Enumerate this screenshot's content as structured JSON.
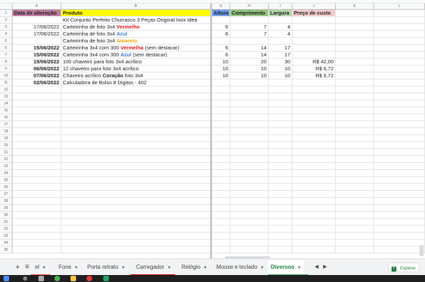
{
  "columns": [
    "A",
    "B",
    "G",
    "H",
    "I",
    "J",
    "K",
    "L"
  ],
  "header": {
    "data": "Data de alteração",
    "produto": "Produto",
    "altura": "Altura",
    "comprimento": "Comprimento",
    "largura": "Largura",
    "preco": "Preço de custo"
  },
  "rows": [
    {
      "n": "2",
      "date": "",
      "prod": "Kit Conjunto Perfeito Churrasco 3 Peças Original Inox Idea",
      "g": "",
      "h": "",
      "i": "",
      "j": ""
    },
    {
      "n": "3",
      "date": "17/06/2022",
      "p1": "Carteirinha de foto 3x4 ",
      "p2": "Vermelho",
      "g": "6",
      "h": "7",
      "i": "4",
      "j": ""
    },
    {
      "n": "4",
      "date": "17/06/2022",
      "p1": "Carteirinha de foto 3x4 ",
      "p2": "Azul",
      "g": "6",
      "h": "7",
      "i": "4",
      "j": ""
    },
    {
      "n": "5",
      "date": "",
      "p1": "Carteirinha de foto 3x4 ",
      "p2": "Amarelo",
      "g": "",
      "h": "",
      "i": "",
      "j": ""
    },
    {
      "n": "6",
      "date": "15/06/2022",
      "p1": "Carteirinha 3x4 com 300 ",
      "p2": "Vermelha",
      "p3": " (sem destacar)",
      "g": "6",
      "h": "14",
      "i": "17",
      "j": ""
    },
    {
      "n": "7",
      "date": "15/06/2022",
      "p1": "Carteirinha 3x4 com 300 ",
      "p2": "Azul",
      "p3": " (sem destacar)",
      "g": "6",
      "h": "14",
      "i": "17",
      "j": ""
    },
    {
      "n": "8",
      "date": "15/06/2022",
      "prod": "100 chaveiro para foto 3x4 acrílico",
      "g": "10",
      "h": "20",
      "i": "30",
      "j": "R$ 42,00"
    },
    {
      "n": "9",
      "date": "06/06/2022",
      "prod": "12 chaveiro para foto 3x4 acrílico",
      "g": "10",
      "h": "10",
      "i": "10",
      "j": "R$ 6,72"
    },
    {
      "n": "10",
      "date": "07/06/2022",
      "p1": "Chaveiro acrílico ",
      "p2": "Coração",
      "p3": " foto 3x4",
      "g": "10",
      "h": "10",
      "i": "10",
      "j": "R$ 6,72"
    },
    {
      "n": "11",
      "date": "02/06/2022",
      "prod": "Calculadora de Bolso 8 Digitos - 402",
      "g": "",
      "h": "",
      "i": "",
      "j": ""
    }
  ],
  "empty_rows": [
    "12",
    "13",
    "14",
    "15",
    "16",
    "17",
    "18",
    "19",
    "20",
    "21",
    "22",
    "23",
    "24",
    "25",
    "26",
    "27",
    "28",
    "29",
    "30",
    "31",
    "32",
    "33",
    "34",
    "35"
  ],
  "tabs": {
    "add": "+",
    "list": "≡",
    "items": [
      {
        "label": "el",
        "color": "#ea4335"
      },
      {
        "label": "Fone",
        "color": ""
      },
      {
        "label": "Porta retrato",
        "color": ""
      },
      {
        "label": "Carregador",
        "color": "#cc0000"
      },
      {
        "label": "Relógio",
        "color": ""
      },
      {
        "label": "Mouse e teclado",
        "color": ""
      },
      {
        "label": "Diversos",
        "color": "#34a853"
      }
    ],
    "explore_label": "Explorar"
  },
  "colors": {
    "date_header_bg": "#c27ba0",
    "produto_header_bg": "#ffff00",
    "altura_header_bg": "#6d9eeb",
    "comprimento_header_bg": "#93c47d",
    "largura_header_bg": "#b6d7a8",
    "preco_header_bg": "#f4cccc"
  }
}
